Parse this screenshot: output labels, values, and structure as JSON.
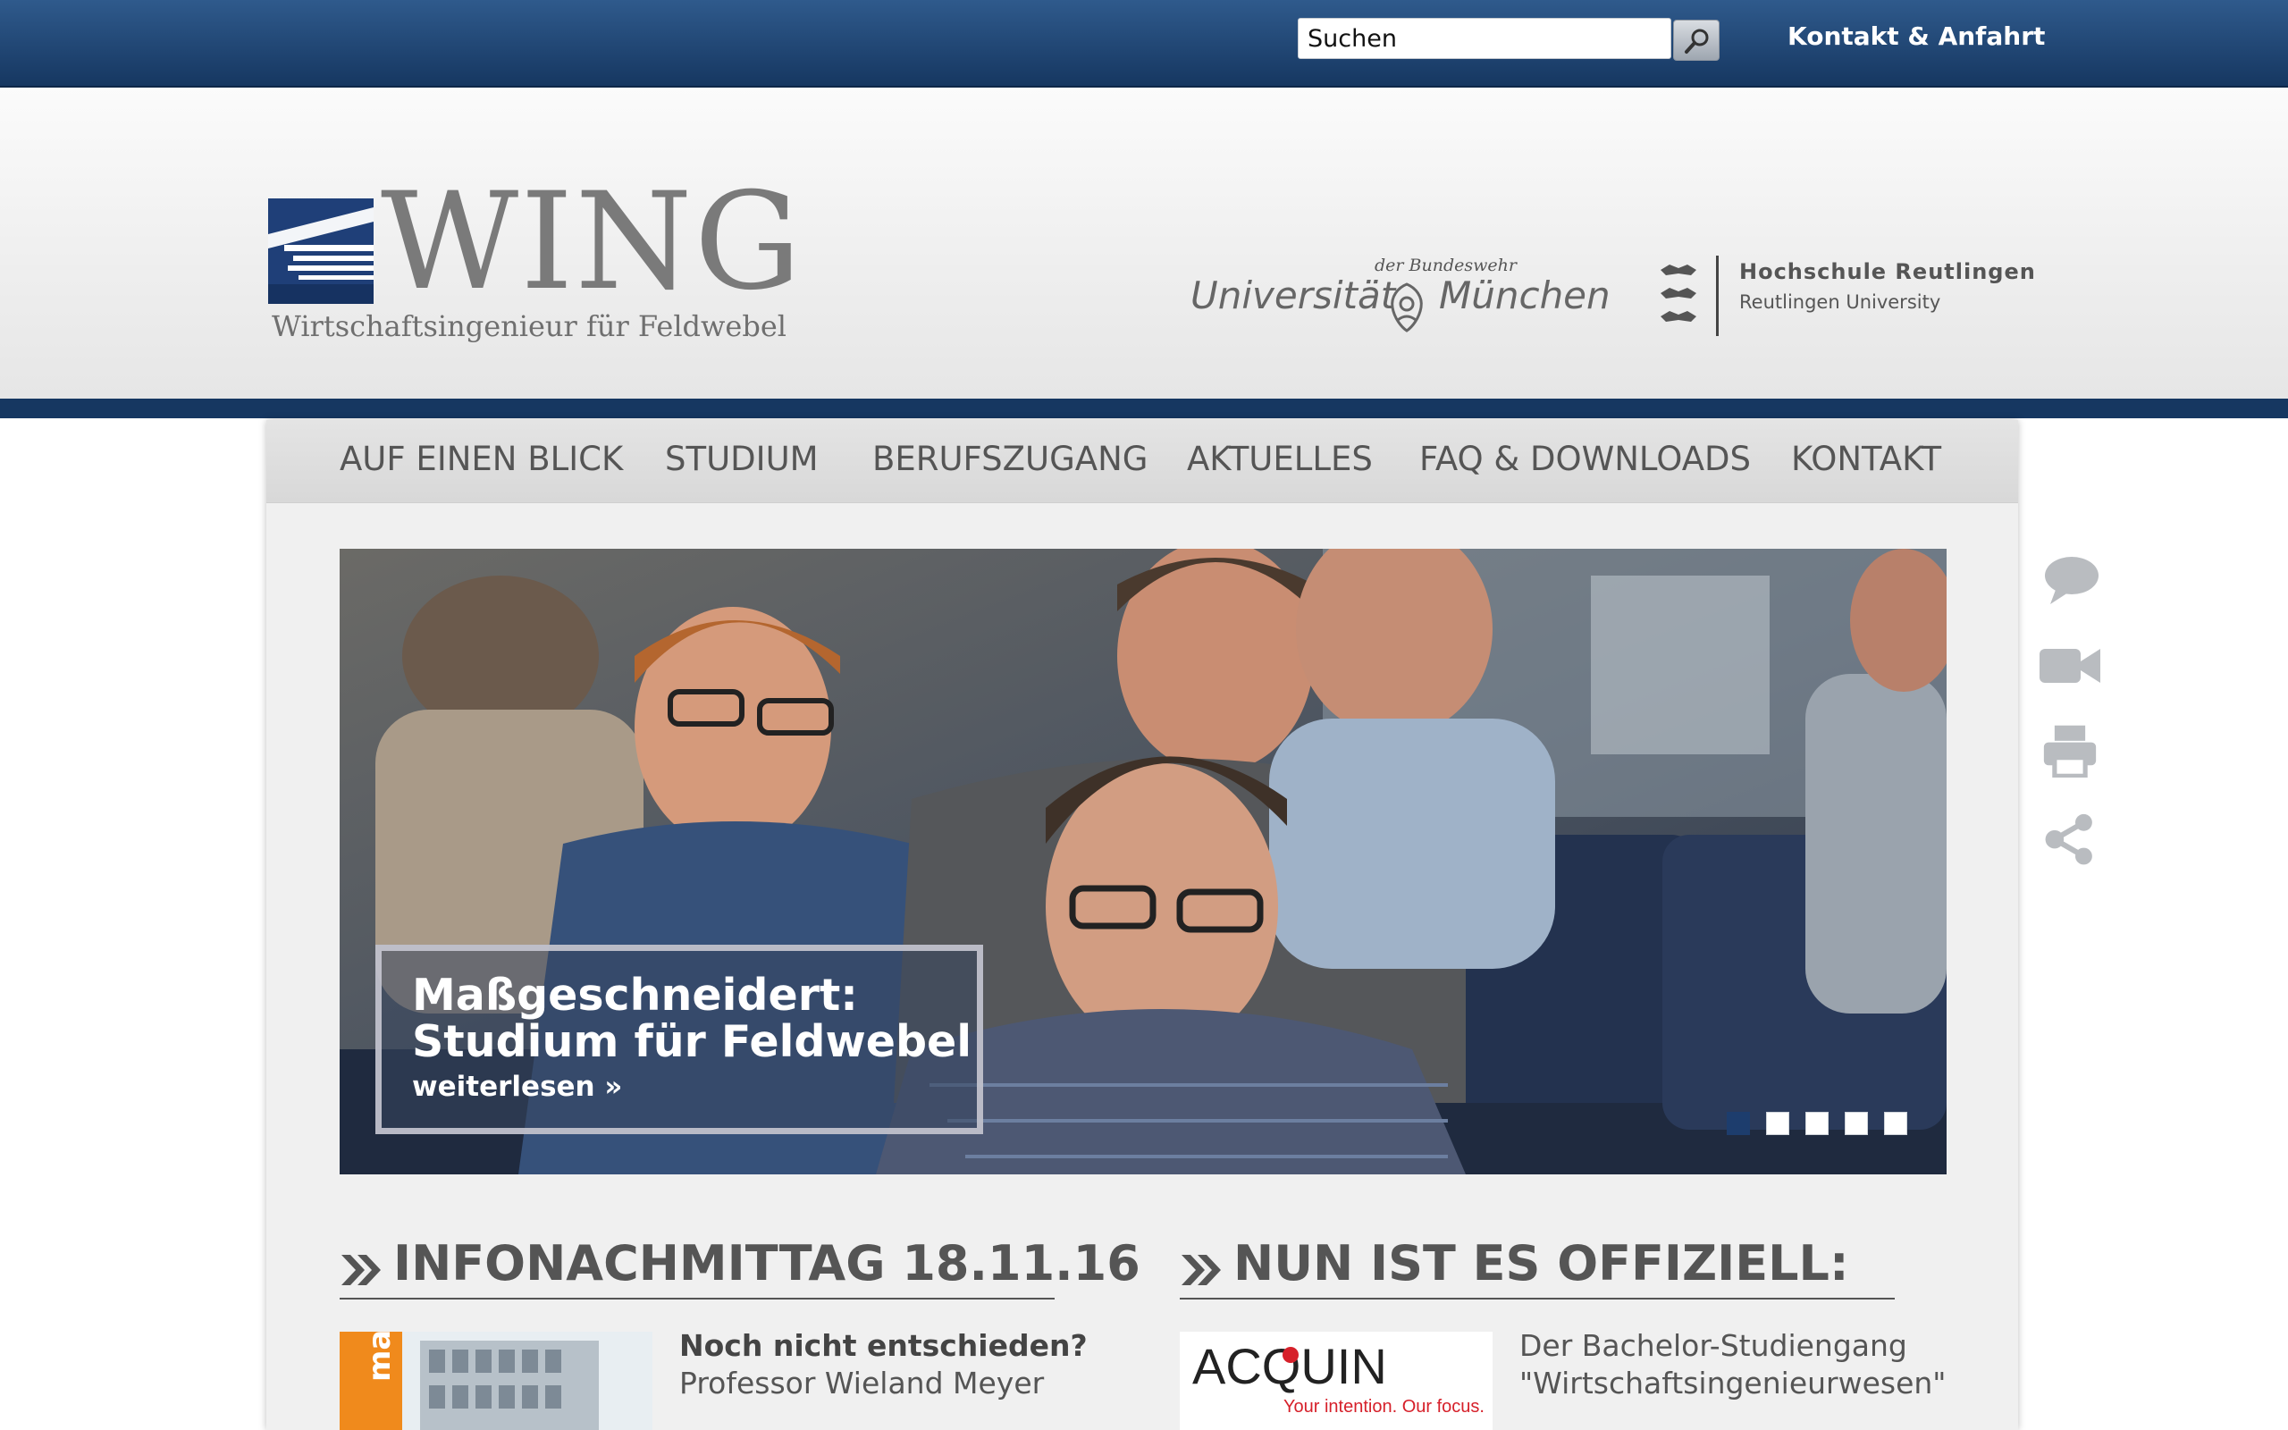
{
  "topbar": {
    "search_placeholder": "Suchen",
    "search_value": "Suchen",
    "contact_link": "Kontakt & Anfahrt"
  },
  "header": {
    "logo_word": "WING",
    "logo_sub": "Wirtschaftsingenieur für Feldwebel",
    "unibw_small": "der Bundeswehr",
    "unibw_left": "Universität",
    "unibw_right": "München",
    "hsrt_name": "Hochschule Reutlingen",
    "hsrt_sub": "Reutlingen University"
  },
  "nav": {
    "items": [
      "AUF EINEN BLICK",
      "STUDIUM",
      "BERUFSZUGANG",
      "AKTUELLES",
      "FAQ & DOWNLOADS",
      "KONTAKT"
    ]
  },
  "slider": {
    "title_line1": "Maßgeschneidert:",
    "title_line2": "Studium für Feldwebel",
    "link": "weiterlesen »",
    "slide_count": 5,
    "active_slide": 1
  },
  "news": [
    {
      "title": "INFONACHMITTAG 18.11.16",
      "subhead": "Noch nicht entschieden?",
      "text": "Professor Wieland Meyer",
      "image_label": "max"
    },
    {
      "title": "NUN IST ES OFFIZIELL:",
      "text_line1": "Der Bachelor-Studiengang",
      "text_line2": "\"Wirtschaftsingenieurwesen\"",
      "image_label": "ACQUIN",
      "image_tagline": "Your intention. Our focus."
    }
  ],
  "side_icons": [
    "speech-bubble-icon",
    "video-camera-icon",
    "printer-icon",
    "share-icon"
  ],
  "colors": {
    "topbar": "#1f477a",
    "band": "#163761",
    "nav_text": "#555555",
    "active_dot": "#1d3d6d"
  }
}
